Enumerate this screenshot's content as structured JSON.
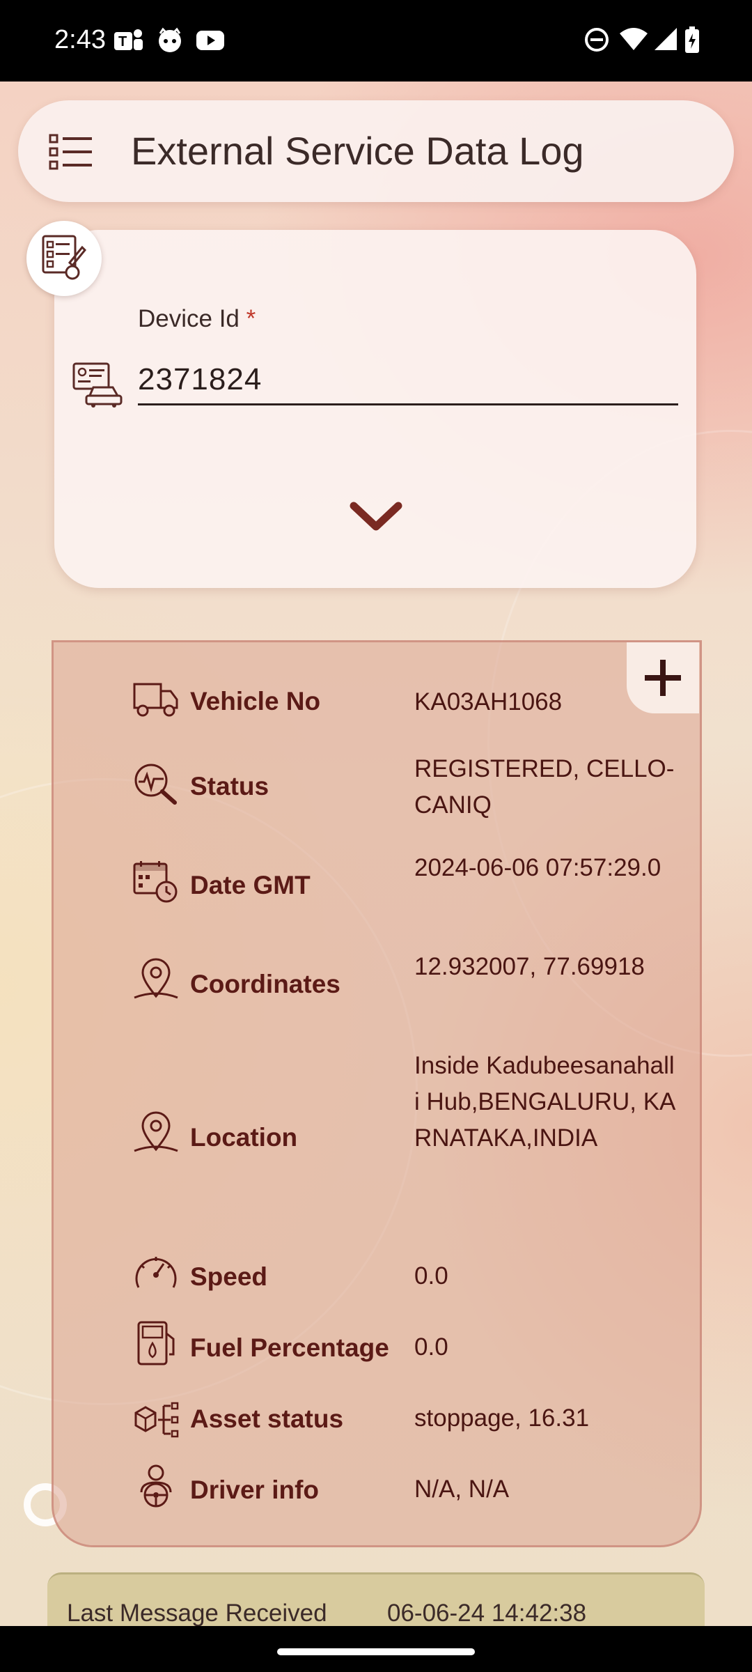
{
  "status_bar": {
    "time": "2:43",
    "left_icons": [
      "teams-icon",
      "cat-face-icon",
      "youtube-icon"
    ],
    "right_icons": [
      "do-not-disturb-icon",
      "wifi-icon",
      "signal-icon",
      "battery-charging-icon"
    ]
  },
  "app_bar": {
    "title": "External Service Data Log",
    "menu_icon": "list-menu-icon"
  },
  "device_form": {
    "label": "Device Id",
    "required_mark": "*",
    "value": "2371824",
    "badge_icon": "checklist-edit-icon",
    "field_icon": "vehicle-id-card-icon",
    "expand_icon": "chevron-down-icon"
  },
  "details": {
    "add_icon": "plus-icon",
    "rows": [
      {
        "label": "Vehicle No",
        "value": "KA03AH1068",
        "icon": "truck-icon"
      },
      {
        "label": "Status",
        "value": "REGISTERED, CELLO-CANIQ",
        "icon": "status-search-icon"
      },
      {
        "label": "Date GMT",
        "value": "2024-06-06 07:57:29.0",
        "icon": "calendar-clock-icon"
      },
      {
        "label": "Coordinates",
        "value": "12.932007, 77.69918",
        "icon": "location-pin-icon"
      },
      {
        "label": "Location",
        "value": "Inside Kadubeesanahalli Hub,BENGALURU, KARNATAKA,INDIA",
        "icon": "location-pin-icon"
      },
      {
        "label": "Speed",
        "value": "0.0",
        "icon": "speedometer-icon"
      },
      {
        "label": "Fuel Percentage",
        "value": "0.0",
        "icon": "fuel-icon"
      },
      {
        "label": "Asset status",
        "value": "stoppage, 16.31",
        "icon": "asset-tree-icon"
      },
      {
        "label": "Driver info",
        "value": "N/A, N/A",
        "icon": "driver-icon"
      }
    ]
  },
  "last_message": {
    "label": "Last Message Received",
    "value": "06-06-24 14:42:38"
  },
  "colors": {
    "label_text": "#5b1a16",
    "value_text": "#4a1512",
    "card_fill": "#dca594",
    "last_message_fill": "#d4c896"
  }
}
